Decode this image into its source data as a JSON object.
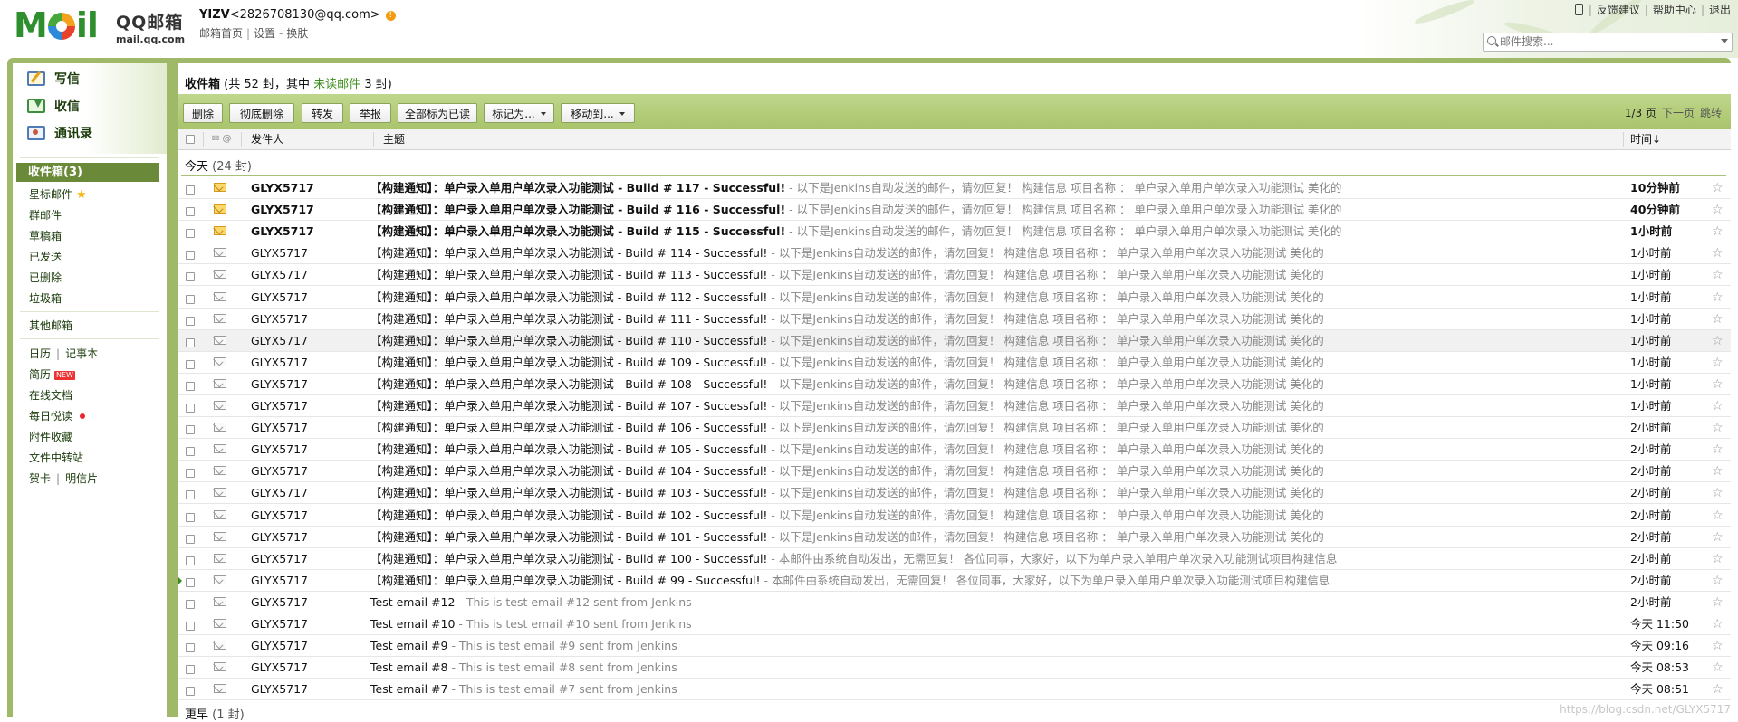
{
  "header": {
    "logo_wordmark": "MOil",
    "logo_title": "QQ邮箱",
    "logo_domain": "mail.qq.com",
    "account_name": "YIZV",
    "account_email": "<2826708130@qq.com>",
    "links": [
      "邮箱首页",
      "设置",
      "换肤"
    ],
    "top_links": [
      "反馈建议",
      "帮助中心",
      "退出"
    ],
    "search_placeholder": "邮件搜索..."
  },
  "sidebar": {
    "quick": [
      {
        "label": "写信",
        "icon": "compose-icon"
      },
      {
        "label": "收信",
        "icon": "inbox-download-icon"
      },
      {
        "label": "通讯录",
        "icon": "contacts-icon"
      }
    ],
    "active_folder": "收件箱(3)",
    "folders": [
      "星标邮件",
      "群邮件",
      "草稿箱",
      "已发送",
      "已删除",
      "垃圾箱"
    ],
    "other_mailbox": "其他邮箱",
    "apps": {
      "calendar": "日历",
      "notes": "记事本",
      "resume": "简历",
      "resume_badge": "NEW",
      "docs": "在线文档",
      "daily": "每日悦读",
      "attachments": "附件收藏",
      "transfer": "文件中转站",
      "card": "贺卡",
      "postcard": "明信片"
    }
  },
  "main": {
    "box_name": "收件箱",
    "box_summary_a": " (共 52 封，其中 ",
    "box_unread_link": "未读邮件",
    "box_summary_b": " 3 封)",
    "toolbar": {
      "delete": "删除",
      "perm_delete": "彻底删除",
      "forward": "转发",
      "report": "举报",
      "mark_all_read": "全部标为已读",
      "mark_as": "标记为...",
      "move_to": "移动到..."
    },
    "pager": {
      "page": "1/3 页",
      "next": "下一页",
      "jump": "跳转"
    },
    "columns": {
      "sender": "发件人",
      "subject": "主题",
      "time": "时间↓"
    },
    "group_today": {
      "label": "今天",
      "count": "(24 封)"
    },
    "group_earlier": {
      "label": "更早",
      "count": "(1 封)"
    },
    "rows": [
      {
        "sender": "GLYX5717",
        "subject": "【构建通知】：单户录入单用户单次录入功能测试 - Build # 117 - Successful!",
        "preview": " -  以下是Jenkins自动发送的邮件，请勿回复！ 构建信息 项目名称 ： 单户录入单用户单次录入功能测试 美化的",
        "time": "10分钟前",
        "unread": true
      },
      {
        "sender": "GLYX5717",
        "subject": "【构建通知】：单户录入单用户单次录入功能测试 - Build # 116 - Successful!",
        "preview": " -  以下是Jenkins自动发送的邮件，请勿回复！ 构建信息 项目名称 ： 单户录入单用户单次录入功能测试 美化的",
        "time": "40分钟前",
        "unread": true
      },
      {
        "sender": "GLYX5717",
        "subject": "【构建通知】：单户录入单用户单次录入功能测试 - Build # 115 - Successful!",
        "preview": " -  以下是Jenkins自动发送的邮件，请勿回复！ 构建信息 项目名称 ： 单户录入单用户单次录入功能测试 美化的",
        "time": "1小时前",
        "unread": true
      },
      {
        "sender": "GLYX5717",
        "subject": "【构建通知】：单户录入单用户单次录入功能测试 - Build # 114 - Successful!",
        "preview": " -  以下是Jenkins自动发送的邮件，请勿回复！ 构建信息 项目名称 ： 单户录入单用户单次录入功能测试 美化的",
        "time": "1小时前",
        "unread": false
      },
      {
        "sender": "GLYX5717",
        "subject": "【构建通知】：单户录入单用户单次录入功能测试 - Build # 113 - Successful!",
        "preview": " -  以下是Jenkins自动发送的邮件，请勿回复！ 构建信息 项目名称 ： 单户录入单用户单次录入功能测试 美化的",
        "time": "1小时前",
        "unread": false
      },
      {
        "sender": "GLYX5717",
        "subject": "【构建通知】：单户录入单用户单次录入功能测试 - Build # 112 - Successful!",
        "preview": " -  以下是Jenkins自动发送的邮件，请勿回复！ 构建信息 项目名称 ： 单户录入单用户单次录入功能测试 美化的",
        "time": "1小时前",
        "unread": false
      },
      {
        "sender": "GLYX5717",
        "subject": "【构建通知】：单户录入单用户单次录入功能测试 - Build # 111 - Successful!",
        "preview": " -  以下是Jenkins自动发送的邮件，请勿回复！ 构建信息 项目名称 ： 单户录入单用户单次录入功能测试 美化的",
        "time": "1小时前",
        "unread": false
      },
      {
        "sender": "GLYX5717",
        "subject": "【构建通知】：单户录入单用户单次录入功能测试 - Build # 110 - Successful!",
        "preview": " -  以下是Jenkins自动发送的邮件，请勿回复！ 构建信息 项目名称 ： 单户录入单用户单次录入功能测试 美化的",
        "time": "1小时前",
        "unread": false,
        "highlight": true
      },
      {
        "sender": "GLYX5717",
        "subject": "【构建通知】：单户录入单用户单次录入功能测试 - Build # 109 - Successful!",
        "preview": " -  以下是Jenkins自动发送的邮件，请勿回复！ 构建信息 项目名称 ： 单户录入单用户单次录入功能测试 美化的",
        "time": "1小时前",
        "unread": false
      },
      {
        "sender": "GLYX5717",
        "subject": "【构建通知】：单户录入单用户单次录入功能测试 - Build # 108 - Successful!",
        "preview": " -  以下是Jenkins自动发送的邮件，请勿回复！ 构建信息 项目名称 ： 单户录入单用户单次录入功能测试 美化的",
        "time": "1小时前",
        "unread": false
      },
      {
        "sender": "GLYX5717",
        "subject": "【构建通知】：单户录入单用户单次录入功能测试 - Build # 107 - Successful!",
        "preview": " -  以下是Jenkins自动发送的邮件，请勿回复！ 构建信息 项目名称 ： 单户录入单用户单次录入功能测试 美化的",
        "time": "1小时前",
        "unread": false
      },
      {
        "sender": "GLYX5717",
        "subject": "【构建通知】：单户录入单用户单次录入功能测试 - Build # 106 - Successful!",
        "preview": " -  以下是Jenkins自动发送的邮件，请勿回复！ 构建信息 项目名称 ： 单户录入单用户单次录入功能测试 美化的",
        "time": "2小时前",
        "unread": false
      },
      {
        "sender": "GLYX5717",
        "subject": "【构建通知】：单户录入单用户单次录入功能测试 - Build # 105 - Successful!",
        "preview": " -  以下是Jenkins自动发送的邮件，请勿回复！ 构建信息 项目名称 ： 单户录入单用户单次录入功能测试 美化的",
        "time": "2小时前",
        "unread": false
      },
      {
        "sender": "GLYX5717",
        "subject": "【构建通知】：单户录入单用户单次录入功能测试 - Build # 104 - Successful!",
        "preview": " -  以下是Jenkins自动发送的邮件，请勿回复！ 构建信息 项目名称 ： 单户录入单用户单次录入功能测试 美化的",
        "time": "2小时前",
        "unread": false
      },
      {
        "sender": "GLYX5717",
        "subject": "【构建通知】：单户录入单用户单次录入功能测试 - Build # 103 - Successful!",
        "preview": " -  以下是Jenkins自动发送的邮件，请勿回复！ 构建信息 项目名称 ： 单户录入单用户单次录入功能测试 美化的",
        "time": "2小时前",
        "unread": false
      },
      {
        "sender": "GLYX5717",
        "subject": "【构建通知】：单户录入单用户单次录入功能测试 - Build # 102 - Successful!",
        "preview": " -  以下是Jenkins自动发送的邮件，请勿回复！ 构建信息 项目名称 ： 单户录入单用户单次录入功能测试 美化的",
        "time": "2小时前",
        "unread": false
      },
      {
        "sender": "GLYX5717",
        "subject": "【构建通知】：单户录入单用户单次录入功能测试 - Build # 101 - Successful!",
        "preview": " -  以下是Jenkins自动发送的邮件，请勿回复！ 构建信息 项目名称 ： 单户录入单用户单次录入功能测试 美化的",
        "time": "2小时前",
        "unread": false
      },
      {
        "sender": "GLYX5717",
        "subject": "【构建通知】：单户录入单用户单次录入功能测试 - Build # 100 - Successful!",
        "preview": " - 本邮件由系统自动发出，无需回复！ 各位同事，大家好，以下为单户录入单用户单次录入功能测试项目构建信息",
        "time": "2小时前",
        "unread": false
      },
      {
        "sender": "GLYX5717",
        "subject": "【构建通知】：单户录入单用户单次录入功能测试 - Build # 99 - Successful!",
        "preview": " - 本邮件由系统自动发出，无需回复！ 各位同事，大家好，以下为单户录入单用户单次录入功能测试项目构建信息",
        "time": "2小时前",
        "unread": false,
        "current": true
      },
      {
        "sender": "GLYX5717",
        "subject": "Test email #12",
        "preview": " - This is test email #12 sent from Jenkins",
        "time": "2小时前",
        "unread": false
      },
      {
        "sender": "GLYX5717",
        "subject": "Test email #10",
        "preview": " - This is test email #10 sent from Jenkins",
        "time": "今天 11:50",
        "unread": false
      },
      {
        "sender": "GLYX5717",
        "subject": "Test email #9",
        "preview": " - This is test email #9 sent from Jenkins",
        "time": "今天 09:16",
        "unread": false
      },
      {
        "sender": "GLYX5717",
        "subject": "Test email #8",
        "preview": " - This is test email #8 sent from Jenkins",
        "time": "今天 08:53",
        "unread": false
      },
      {
        "sender": "GLYX5717",
        "subject": "Test email #7",
        "preview": " - This is test email #7 sent from Jenkins",
        "time": "今天 08:51",
        "unread": false
      }
    ]
  },
  "watermark": "https://blog.csdn.net/GLYX5717",
  "colors": {
    "frame_green": "#9fb968",
    "toolbar_green": "#b5cf7e",
    "active_folder": "#6a8a3a",
    "unread_link": "#3a8e1a"
  }
}
